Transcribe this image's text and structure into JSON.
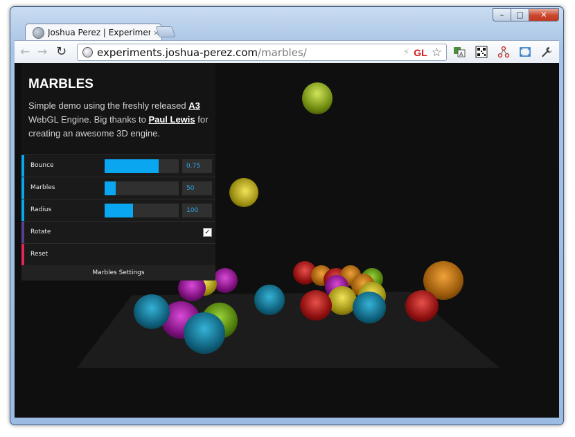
{
  "browser": {
    "tab_title": "Joshua Perez | Experiments",
    "tab_close": "×",
    "url_host": "experiments.joshua-perez.com",
    "url_path": "/marbles/",
    "gl_badge": "GL",
    "window_buttons": {
      "minimize": "–",
      "maximize": "□",
      "close": "✕"
    },
    "nav": {
      "back": "←",
      "forward": "→",
      "reload": "↻"
    },
    "icons": {
      "star": "☆",
      "bolt": "⚡",
      "wrench": "🔧"
    }
  },
  "panel": {
    "title": "MARBLES",
    "desc_pre": "Simple demo using the freshly released ",
    "link_a3": "A3",
    "desc_mid": " WebGL Engine. Big thanks to ",
    "link_paul": "Paul Lewis",
    "desc_post": " for creating an awesome 3D engine.",
    "controls": [
      {
        "label": "Bounce",
        "value": "0.75",
        "fraction": 0.75,
        "color": "#0aa7f0"
      },
      {
        "label": "Marbles",
        "value": "50",
        "fraction": 0.15,
        "color": "#0aa7f0"
      },
      {
        "label": "Radius",
        "value": "100",
        "fraction": 0.38,
        "color": "#0aa7f0"
      },
      {
        "label": "Rotate",
        "checked": true,
        "color": "#5b3f8f"
      },
      {
        "label": "Reset",
        "color": "#e3255a"
      }
    ],
    "settings_label": "Marbles Settings"
  }
}
